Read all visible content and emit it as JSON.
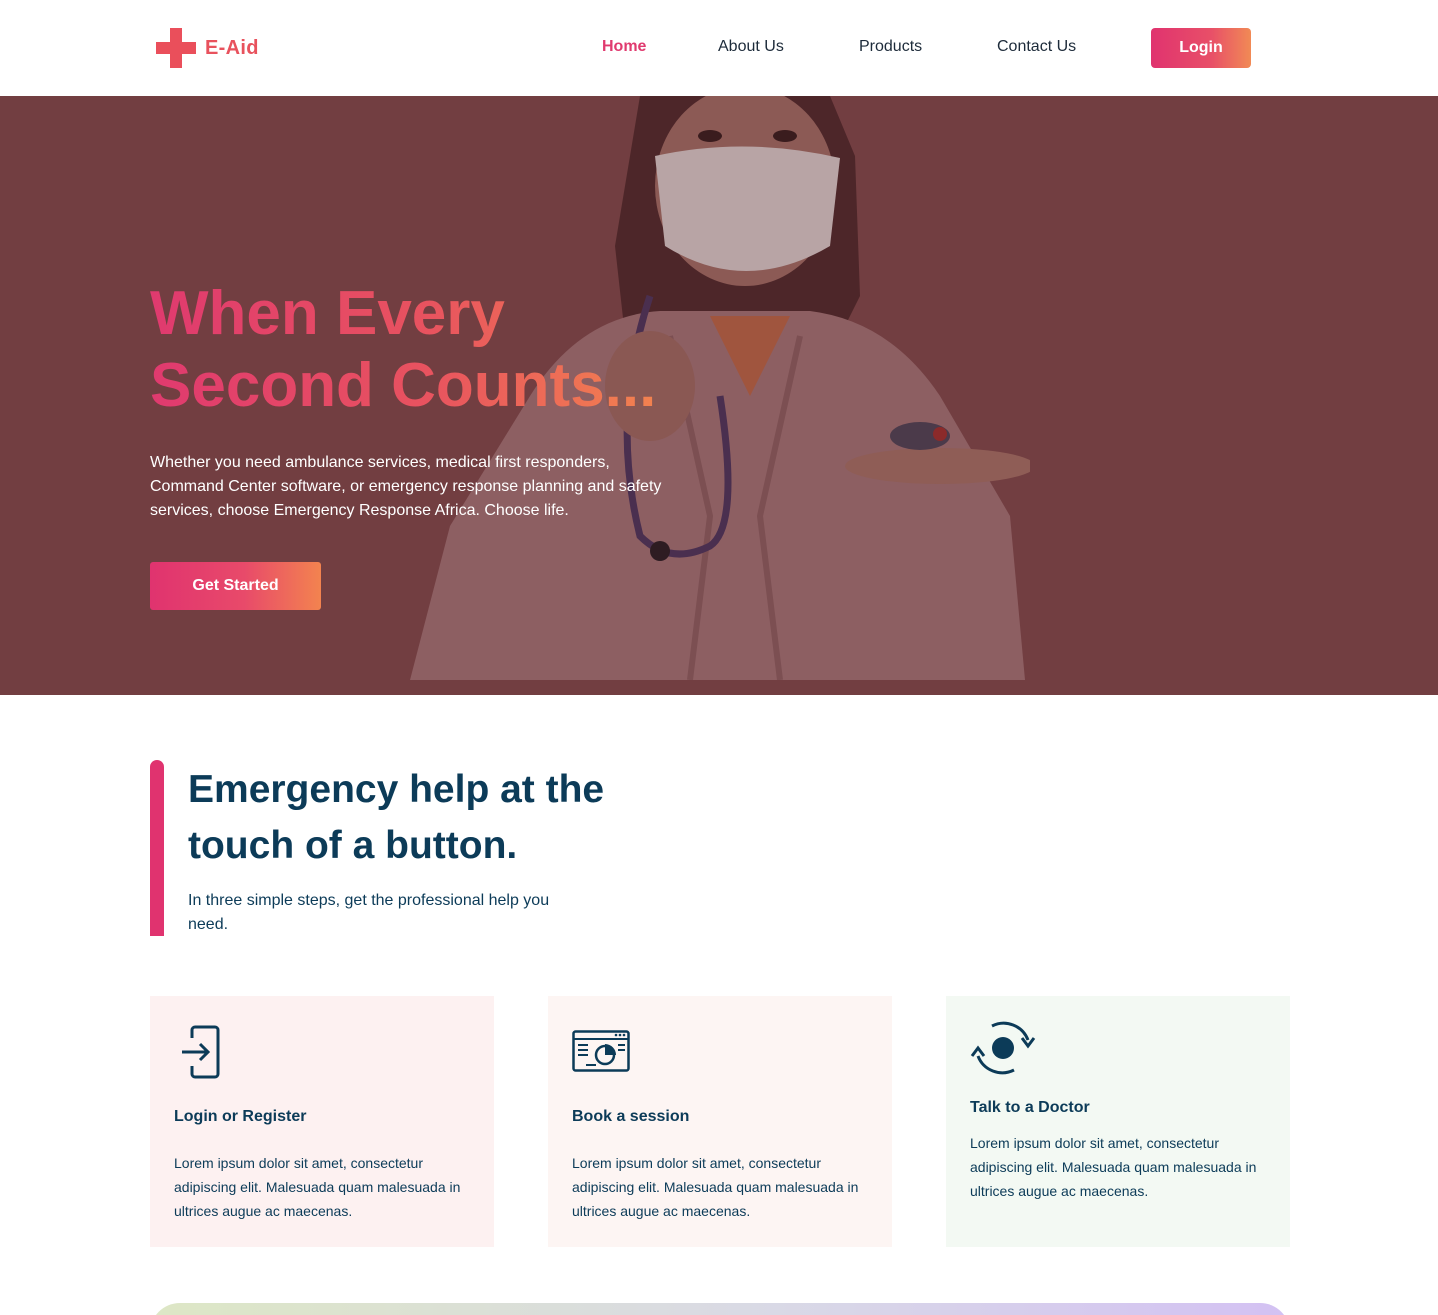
{
  "brand": {
    "name": "E-Aid",
    "color": "#e8525d"
  },
  "nav": {
    "items": [
      {
        "label": "Home",
        "active": true
      },
      {
        "label": "About Us",
        "active": false
      },
      {
        "label": "Products",
        "active": false
      },
      {
        "label": "Contact Us",
        "active": false
      }
    ],
    "login_label": "Login"
  },
  "hero": {
    "title_line1": "When Every",
    "title_line2": "Second Counts...",
    "description": "Whether you need ambulance services, medical first responders, Command Center software, or emergency response planning and safety services, choose Emergency Response Africa. Choose life.",
    "cta_label": "Get Started",
    "image_icon": "doctor-photo"
  },
  "section": {
    "title": "Emergency help at the touch of a button.",
    "subtitle": "In three simple steps, get the professional help you need."
  },
  "cards": [
    {
      "icon": "login-icon",
      "title": "Login or Register",
      "text": "Lorem ipsum dolor sit amet, consectetur adipiscing elit. Malesuada quam malesuada in ultrices augue ac maecenas."
    },
    {
      "icon": "booking-dashboard-icon",
      "title": "Book a session",
      "text": "Lorem ipsum dolor sit amet, consectetur adipiscing elit. Malesuada quam malesuada in ultrices augue ac maecenas."
    },
    {
      "icon": "sync-icon",
      "title": "Talk to a Doctor",
      "text": "Lorem ipsum dolor sit amet, consectetur adipiscing elit. Malesuada quam malesuada in ultrices augue ac maecenas."
    }
  ],
  "colors": {
    "accent": "#e0336f",
    "gradient_end": "#f18a55",
    "hero_overlay": "#723e41",
    "heading": "#0c3b58"
  }
}
